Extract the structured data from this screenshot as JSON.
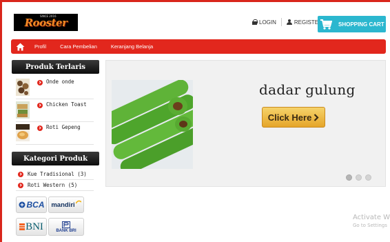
{
  "header": {
    "logo_text": "Rooster",
    "logo_tagline": "SINCE 2016",
    "login_label": "LOGIN",
    "register_label": "REGISTER",
    "cart_label": "SHOPPING CART",
    "cart_color": "#2bb7cf"
  },
  "nav": {
    "items": [
      {
        "label": "Profil"
      },
      {
        "label": "Cara Pembelian"
      },
      {
        "label": "Keranjang Belanja"
      }
    ],
    "color": "#e2271d"
  },
  "sidebar": {
    "bestseller_title": "Produk Terlaris",
    "products": [
      {
        "name": "Onde onde",
        "icon": "onde-onde-thumbnail"
      },
      {
        "name": "Chicken Toast",
        "icon": "chicken-toast-thumbnail"
      },
      {
        "name": "Roti Gepeng",
        "icon": "roti-gepeng-thumbnail"
      }
    ],
    "category_title": "Kategori Produk",
    "categories": [
      {
        "name": "Kue Tradisional (3)"
      },
      {
        "name": "Roti Western (5)"
      }
    ],
    "banks": [
      {
        "name": "BCA"
      },
      {
        "name": "mandiri"
      },
      {
        "name": "BNI"
      },
      {
        "name": "BANK BRI"
      }
    ]
  },
  "slider": {
    "title": "dadar gulung",
    "button_label": "Click Here",
    "active_slide": 1,
    "slide_count": 3
  },
  "watermark": {
    "line1": "Activate W",
    "line2": "Go to Settings"
  }
}
